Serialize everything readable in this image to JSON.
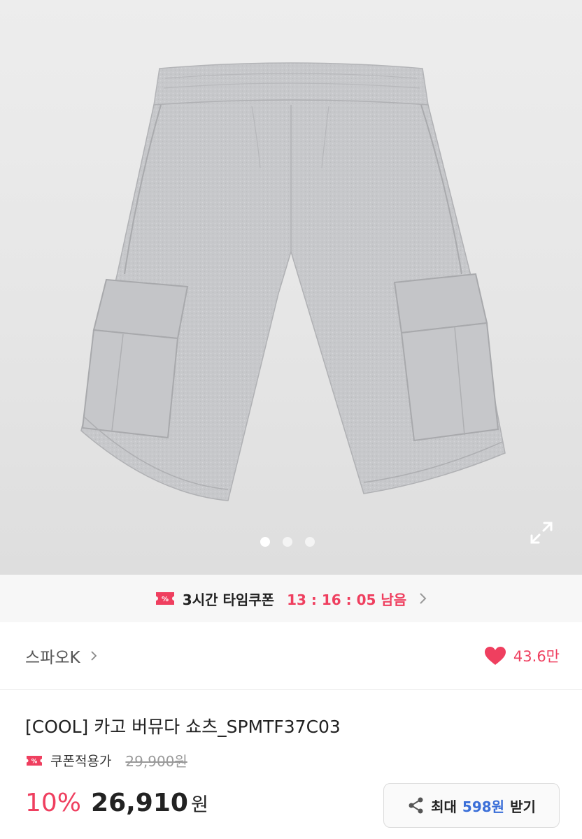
{
  "hero": {
    "slide_count": 3,
    "active_slide": 1
  },
  "time_coupon": {
    "icon": "coupon-ticket-icon",
    "label": "3시간 타임쿠폰",
    "timer": "13 : 16 : 05 남음"
  },
  "brand": {
    "name": "스파오K",
    "likes": "43.6만"
  },
  "product": {
    "title": "[COOL] 카고 버뮤다 쇼츠_SPMTF37C03",
    "coupon_label": "쿠폰적용가",
    "original_price": "29,900원",
    "discount": "10%",
    "price": "26,910",
    "currency": "원"
  },
  "share": {
    "prefix": "최대",
    "points": "598원",
    "suffix": "받기"
  },
  "colors": {
    "accent": "#ef3f5f",
    "points": "#3b6fd8"
  }
}
